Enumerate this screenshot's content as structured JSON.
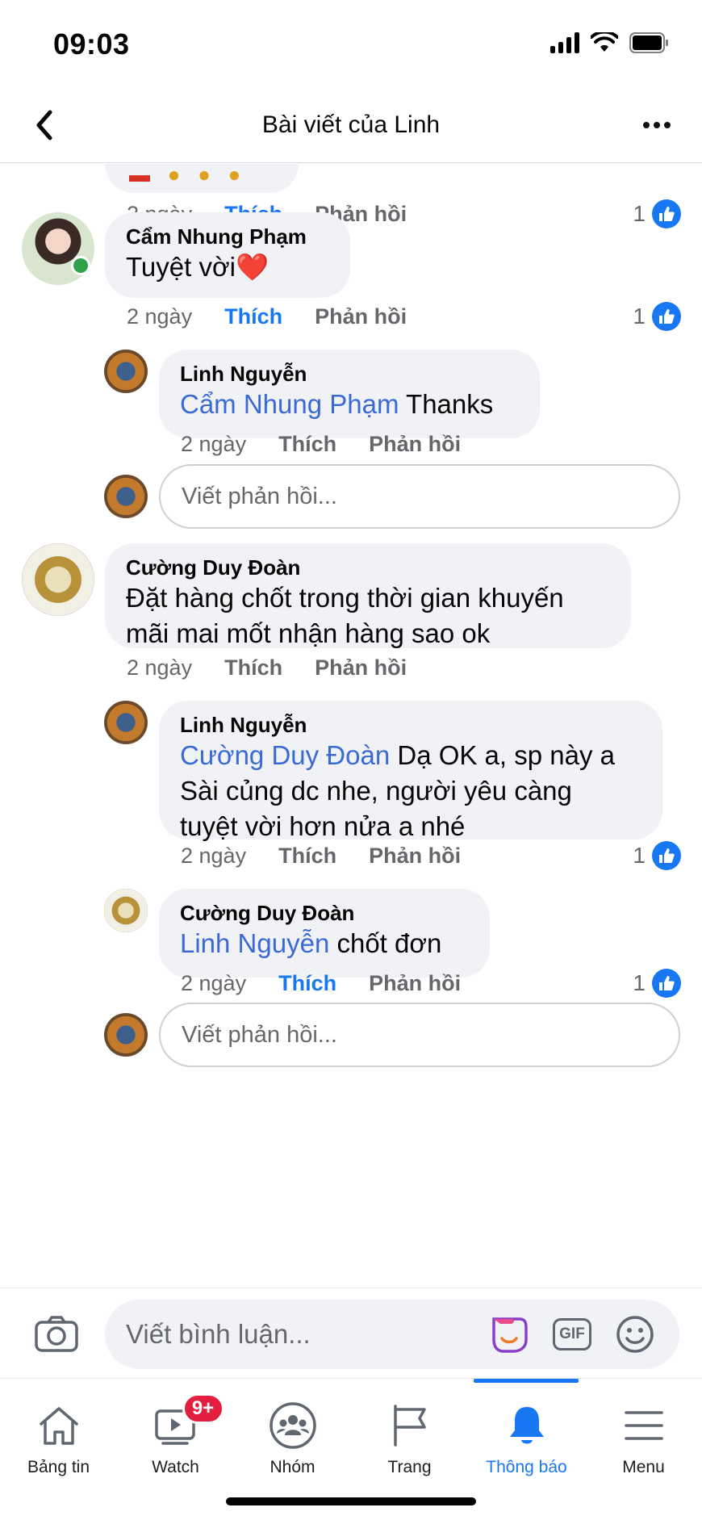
{
  "status_bar": {
    "time": "09:03"
  },
  "nav": {
    "title": "Bài viết của Linh"
  },
  "labels": {
    "like": "Thích",
    "reply": "Phản hồi"
  },
  "reply_placeholder": "Viết phản hồi...",
  "comments": [
    {
      "time": "2 ngày",
      "likes": "1"
    },
    {
      "author": "Cẩm Nhung Phạm",
      "text": "Tuyệt vời",
      "emoji": "❤️",
      "time": "2 ngày",
      "likes": "1"
    },
    {
      "author": "Linh Nguyễn",
      "mention": "Cẩm Nhung Phạm",
      "text": " Thanks",
      "time": "2 ngày"
    },
    {
      "author": "Cường Duy Đoàn",
      "line1": "Đặt hàng chốt trong thời gian khuyến",
      "line2": "mãi mai mốt nhận hàng sao ok",
      "time": "2 ngày"
    },
    {
      "author": "Linh Nguyễn",
      "mention": "Cường Duy Đoàn",
      "line1_rest": " Dạ OK a, sp này a",
      "line2": "Sài củng dc nhe, người yêu càng",
      "line3": "tuyệt vời hơn nửa a nhé",
      "time": "2 ngày",
      "likes": "1"
    },
    {
      "author": "Cường Duy Đoàn",
      "mention": "Linh Nguyễn",
      "text": " chốt đơn",
      "time": "2 ngày",
      "likes": "1"
    }
  ],
  "composer": {
    "placeholder": "Viết bình luận...",
    "gif_label": "GIF"
  },
  "tabs": [
    {
      "label": "Bảng tin",
      "icon": "home-icon"
    },
    {
      "label": "Watch",
      "icon": "watch-icon",
      "badge": "9+"
    },
    {
      "label": "Nhóm",
      "icon": "groups-icon"
    },
    {
      "label": "Trang",
      "icon": "flag-icon"
    },
    {
      "label": "Thông báo",
      "icon": "bell-icon",
      "active": true
    },
    {
      "label": "Menu",
      "icon": "menu-icon"
    }
  ],
  "colors": {
    "accent": "#1877f2",
    "mention": "#3a6ad6",
    "bubble": "#f0f2f5",
    "badge": "#e41e3f",
    "online": "#31a24c"
  }
}
